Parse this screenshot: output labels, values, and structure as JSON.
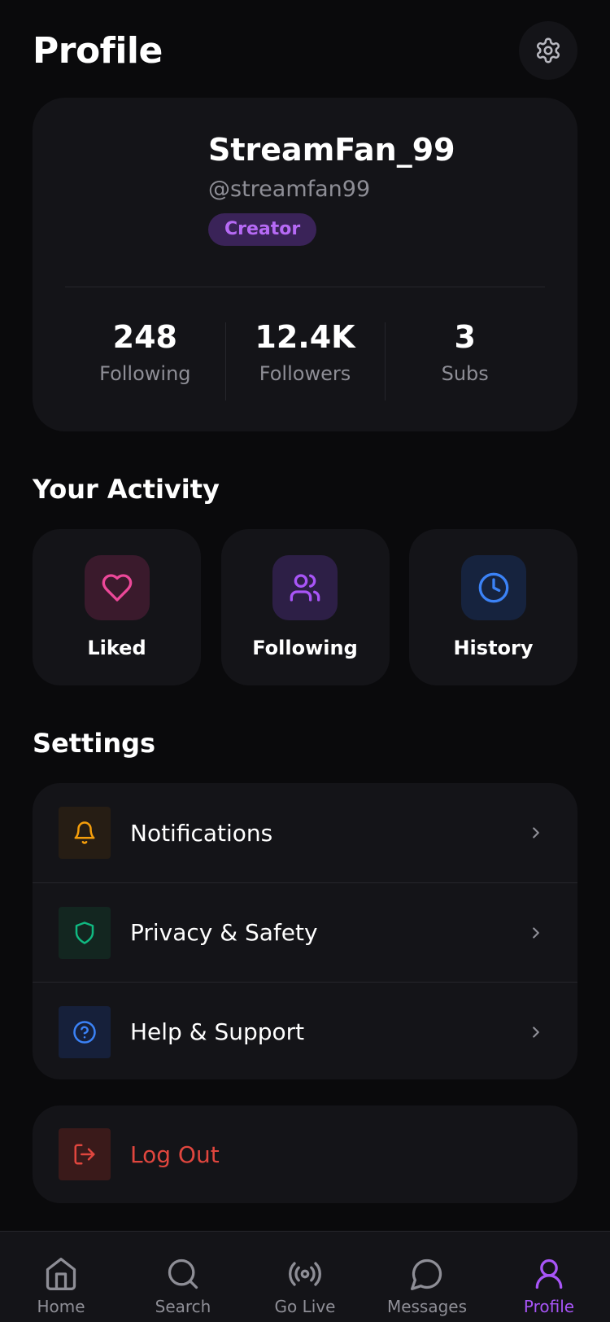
{
  "header": {
    "title": "Profile",
    "settings_icon": "gear-icon"
  },
  "profile": {
    "display_name": "StreamFan_99",
    "handle": "@streamfan99",
    "badge": "Creator",
    "stats": [
      {
        "value": "248",
        "label": "Following"
      },
      {
        "value": "12.4K",
        "label": "Followers"
      },
      {
        "value": "3",
        "label": "Subs"
      }
    ]
  },
  "activity": {
    "title": "Your Activity",
    "items": [
      {
        "label": "Liked",
        "icon": "heart-icon",
        "color": "#ec4899"
      },
      {
        "label": "Following",
        "icon": "users-icon",
        "color": "#a855f7"
      },
      {
        "label": "History",
        "icon": "clock-icon",
        "color": "#3b82f6"
      }
    ]
  },
  "settings": {
    "title": "Settings",
    "items": [
      {
        "label": "Notifications",
        "icon": "bell-icon",
        "color": "#f59e0b"
      },
      {
        "label": "Privacy & Safety",
        "icon": "shield-icon",
        "color": "#10b981"
      },
      {
        "label": "Help & Support",
        "icon": "help-circle-icon",
        "color": "#3b82f6"
      }
    ]
  },
  "logout": {
    "label": "Log Out",
    "icon": "log-out-icon",
    "color": "#e0463e"
  },
  "tabbar": {
    "items": [
      {
        "label": "Home",
        "icon": "home-icon"
      },
      {
        "label": "Search",
        "icon": "search-icon"
      },
      {
        "label": "Go Live",
        "icon": "broadcast-icon"
      },
      {
        "label": "Messages",
        "icon": "message-icon"
      },
      {
        "label": "Profile",
        "icon": "user-icon",
        "active": true
      }
    ]
  },
  "colors": {
    "accent": "#a855f7",
    "background": "#0a0a0c",
    "card": "#141418",
    "muted_text": "#8e8e96"
  }
}
